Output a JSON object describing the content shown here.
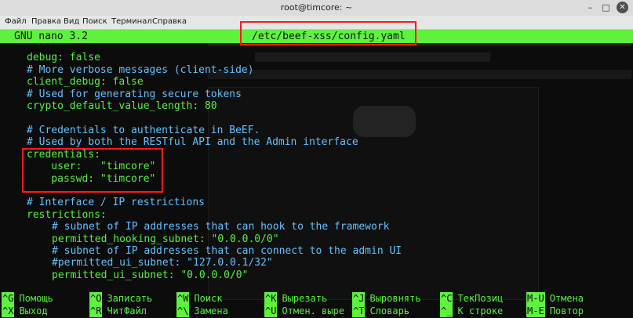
{
  "window": {
    "title": "root@timcore: ~",
    "buttons": {
      "minimize": "–",
      "maximize": "□",
      "close": "✕"
    }
  },
  "menu": [
    "Файл",
    "Правка",
    "Вид",
    "Поиск",
    "Терминал",
    "Справка"
  ],
  "nano": {
    "version": "GNU nano 3.2",
    "file": "/etc/beef-xss/config.yaml"
  },
  "lines": [
    {
      "text": "debug: false",
      "type": "key",
      "indent": 0
    },
    {
      "text": "# More verbose messages (client-side)",
      "type": "comment",
      "indent": 0
    },
    {
      "text": "client_debug: false",
      "type": "key",
      "indent": 0
    },
    {
      "text": "# Used for generating secure tokens",
      "type": "comment",
      "indent": 0
    },
    {
      "text": "crypto_default_value_length: 80",
      "type": "key",
      "indent": 0
    },
    {
      "text": "",
      "type": "blank",
      "indent": 0
    },
    {
      "text": "# Credentials to authenticate in BeEF.",
      "type": "comment",
      "indent": 0
    },
    {
      "text": "# Used by both the RESTful API and the Admin interface",
      "type": "comment",
      "indent": 0
    },
    {
      "text": "credentials:",
      "type": "key",
      "indent": 0
    },
    {
      "text": "    user:   \"timcore\"",
      "type": "key",
      "indent": 0
    },
    {
      "text": "    passwd: \"timcore\"",
      "type": "key",
      "indent": 0
    },
    {
      "text": "",
      "type": "blank",
      "indent": 0
    },
    {
      "text": "# Interface / IP restrictions",
      "type": "comment",
      "indent": 0
    },
    {
      "text": "restrictions:",
      "type": "key",
      "indent": 0
    },
    {
      "text": "# subnet of IP addresses that can hook to the framework",
      "type": "comment",
      "indent": 1
    },
    {
      "text": "permitted_hooking_subnet: \"0.0.0.0/0\"",
      "type": "key",
      "indent": 1
    },
    {
      "text": "# subnet of IP addresses that can connect to the admin UI",
      "type": "comment",
      "indent": 1
    },
    {
      "text": "#permitted_ui_subnet: \"127.0.0.1/32\"",
      "type": "comment",
      "indent": 1
    },
    {
      "text": "permitted_ui_subnet: \"0.0.0.0/0\"",
      "type": "key",
      "indent": 1
    }
  ],
  "shortcuts": [
    {
      "key": "^G",
      "label": "Помощь"
    },
    {
      "key": "^X",
      "label": "Выход"
    },
    {
      "key": "^O",
      "label": "Записать"
    },
    {
      "key": "^R",
      "label": "ЧитФайл"
    },
    {
      "key": "^W",
      "label": "Поиск"
    },
    {
      "key": "^\\",
      "label": "Замена"
    },
    {
      "key": "^K",
      "label": "Вырезать"
    },
    {
      "key": "^U",
      "label": "Отмен. выре"
    },
    {
      "key": "^J",
      "label": "Выровнять"
    },
    {
      "key": "^T",
      "label": "Словарь"
    },
    {
      "key": "^C",
      "label": "ТекПозиц"
    },
    {
      "key": "^_",
      "label": "К строке"
    },
    {
      "key": "M-U",
      "label": "Отмена"
    },
    {
      "key": "M-E",
      "label": "Повтор"
    }
  ],
  "colors": {
    "nano_bar": "#5ef23f",
    "key_text": "#56f13a",
    "comment_text": "#62c1ff",
    "annotation": "#ff1a1a"
  }
}
